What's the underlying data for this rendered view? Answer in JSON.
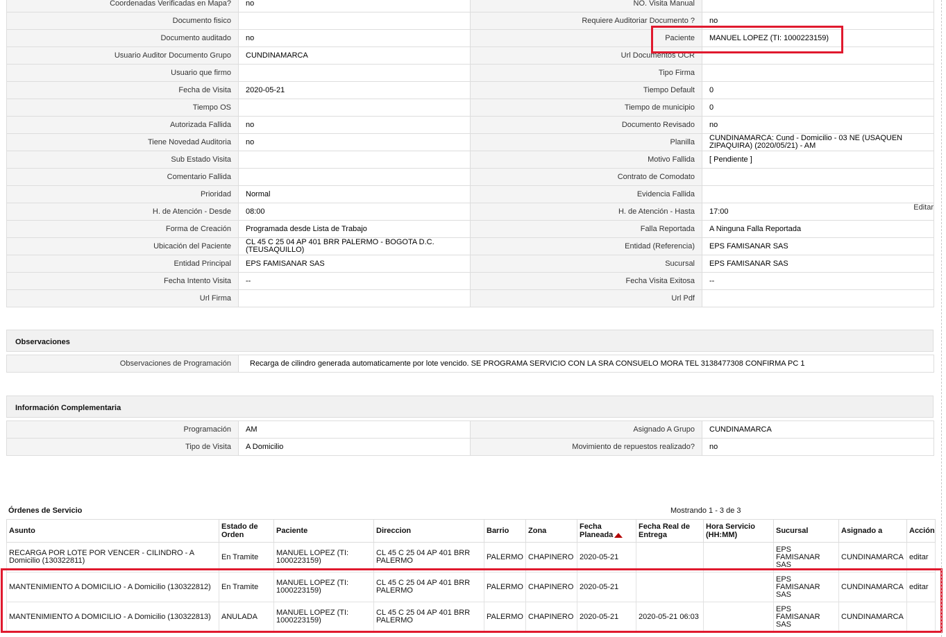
{
  "detail_rows": [
    [
      "Coordenadas Verificadas en Mapa?",
      "no",
      "NO. Visita Manual",
      ""
    ],
    [
      "Documento fisico",
      "",
      "Requiere Auditoriar Documento ?",
      "no"
    ],
    [
      "Documento auditado",
      "no",
      "Paciente",
      "MANUEL LOPEZ (TI: 1000223159)"
    ],
    [
      "Usuario Auditor Documento Grupo",
      "CUNDINAMARCA",
      "Url Documentos OCR",
      ""
    ],
    [
      "Usuario que firmo",
      "",
      "Tipo Firma",
      ""
    ],
    [
      "Fecha de Visita",
      "2020-05-21",
      "Tiempo Default",
      "0"
    ],
    [
      "Tiempo OS",
      "",
      "Tiempo de municipio",
      "0"
    ],
    [
      "Autorizada Fallida",
      "no",
      "Documento Revisado",
      "no"
    ],
    [
      "Tiene Novedad Auditoria",
      "no",
      "Planilla",
      "CUNDINAMARCA: Cund - Domicilio - 03 NE (USAQUEN ZIPAQUIRA) (2020/05/21) - AM"
    ],
    [
      "Sub Estado Visita",
      "",
      "Motivo Fallida",
      "[ Pendiente ]"
    ],
    [
      "Comentario Fallida",
      "",
      "Contrato de Comodato",
      ""
    ],
    [
      "Prioridad",
      "Normal",
      "Evidencia Fallida",
      ""
    ],
    [
      "H. de Atención - Desde",
      "08:00",
      "H. de Atención - Hasta",
      "17:00"
    ],
    [
      "Forma de Creación",
      "Programada desde Lista de Trabajo",
      "Falla Reportada",
      "A Ninguna Falla Reportada"
    ],
    [
      "Ubicación del Paciente",
      "CL 45 C 25 04 AP 401 BRR PALERMO - BOGOTA D.C. (TEUSAQUILLO)",
      "Entidad (Referencia)",
      "EPS FAMISANAR SAS"
    ],
    [
      "Entidad Principal",
      "EPS FAMISANAR SAS",
      "Sucursal",
      "EPS FAMISANAR SAS"
    ],
    [
      "Fecha Intento Visita",
      "--",
      "Fecha Visita Exitosa",
      "--"
    ],
    [
      "Url Firma",
      "",
      "Url Pdf",
      ""
    ]
  ],
  "edit_label": "Editar",
  "observaciones": {
    "title": "Observaciones",
    "label": "Observaciones de Programación",
    "value": "Recarga de cilindro generada automaticamente por lote vencido. SE PROGRAMA SERVICIO CON LA SRA CONSUELO MORA TEL 3138477308 CONFIRMA PC 1"
  },
  "complementaria": {
    "title": "Información Complementaria",
    "rows": [
      [
        "Programación",
        "AM",
        "Asignado A Grupo",
        "CUNDINAMARCA"
      ],
      [
        "Tipo de Visita",
        "A Domicilio",
        "Movimiento de repuestos realizado?",
        "no"
      ]
    ]
  },
  "orders": {
    "title": "Órdenes de Servicio",
    "showing": "Mostrando 1 - 3 de 3",
    "headers": [
      "Asunto",
      "Estado de Orden",
      "Paciente",
      "Direccion",
      "Barrio",
      "Zona",
      "Fecha Planeada",
      "Fecha Real de Entrega",
      "Hora Servicio (HH:MM)",
      "Sucursal",
      "Asignado a",
      "Acción"
    ],
    "rows": [
      [
        "RECARGA POR LOTE POR VENCER - CILINDRO - A Domicilio (130322811)",
        "En Tramite",
        "MANUEL LOPEZ (TI: 1000223159)",
        "CL 45 C 25 04 AP 401 BRR PALERMO",
        "PALERMO",
        "CHAPINERO",
        "2020-05-21",
        "",
        "",
        "EPS FAMISANAR SAS",
        "CUNDINAMARCA",
        "editar"
      ],
      [
        "MANTENIMIENTO A DOMICILIO - A Domicilio (130322812)",
        "En Tramite",
        "MANUEL LOPEZ (TI: 1000223159)",
        "CL 45 C 25 04 AP 401 BRR PALERMO",
        "PALERMO",
        "CHAPINERO",
        "2020-05-21",
        "",
        "",
        "EPS FAMISANAR SAS",
        "CUNDINAMARCA",
        "editar"
      ],
      [
        "MANTENIMIENTO A DOMICILIO - A Domicilio (130322813)",
        "ANULADA",
        "MANUEL LOPEZ (TI: 1000223159)",
        "CL 45 C 25 04 AP 401 BRR PALERMO",
        "PALERMO",
        "CHAPINERO",
        "2020-05-21",
        "2020-05-21 06:03",
        "",
        "EPS FAMISANAR SAS",
        "CUNDINAMARCA",
        ""
      ]
    ]
  },
  "colors": {
    "highlight": "#e0192e",
    "sort_arrow": "#b40000",
    "label_bg": "#f4f4f4"
  }
}
